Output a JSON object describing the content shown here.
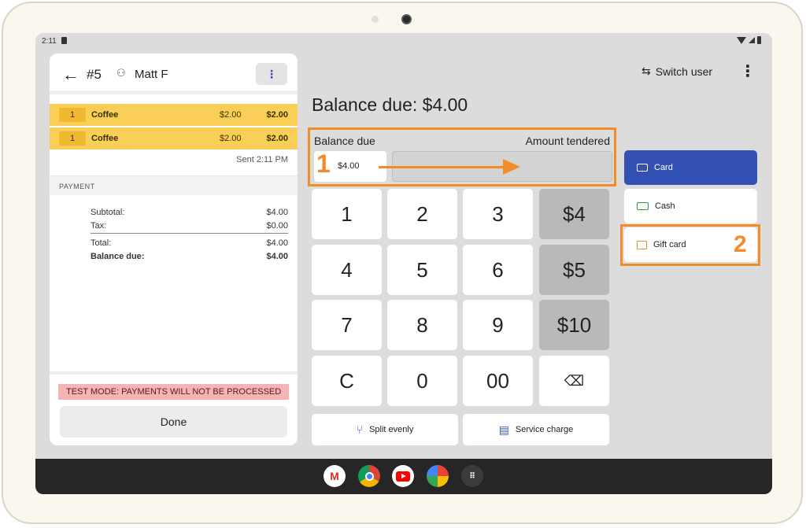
{
  "status_bar": {
    "time": "2:11"
  },
  "order": {
    "number": "#5",
    "user": "Matt F"
  },
  "items": [
    {
      "qty": "1",
      "name": "Coffee",
      "price": "$2.00",
      "total": "$2.00"
    },
    {
      "qty": "1",
      "name": "Coffee",
      "price": "$2.00",
      "total": "$2.00"
    }
  ],
  "sent_label": "Sent 2:11 PM",
  "payment": {
    "header": "PAYMENT",
    "subtotal_label": "Subtotal:",
    "subtotal": "$4.00",
    "tax_label": "Tax:",
    "tax": "$0.00",
    "total_label": "Total:",
    "total": "$4.00",
    "balance_label": "Balance due:",
    "balance": "$4.00"
  },
  "test_mode": "TEST MODE:  PAYMENTS WILL NOT BE PROCESSED",
  "done_label": "Done",
  "header": {
    "switch_user": "Switch user"
  },
  "balance_title": "Balance due: $4.00",
  "tender": {
    "balance_label": "Balance due",
    "tendered_label": "Amount tendered",
    "balance_value": "$4.00",
    "callout_1": "1"
  },
  "keypad": {
    "k1": "1",
    "k2": "2",
    "k3": "3",
    "q4": "$4",
    "k4": "4",
    "k5": "5",
    "k6": "6",
    "q5": "$5",
    "k7": "7",
    "k8": "8",
    "k9": "9",
    "q10": "$10",
    "kc": "C",
    "k0": "0",
    "k00": "00",
    "backspace": "⌫"
  },
  "actions": {
    "split": "Split evenly",
    "service": "Service charge"
  },
  "payment_methods": {
    "card": "Card",
    "cash": "Cash",
    "gift": "Gift card",
    "callout_2": "2"
  },
  "taskbar": [
    "Gmail",
    "Chrome",
    "YouTube",
    "Photos",
    "App drawer"
  ],
  "colors": {
    "accent": "#3351b5",
    "item_highlight": "#f9cf58",
    "callout": "#f28c28",
    "test_mode": "#f5b3b3"
  }
}
